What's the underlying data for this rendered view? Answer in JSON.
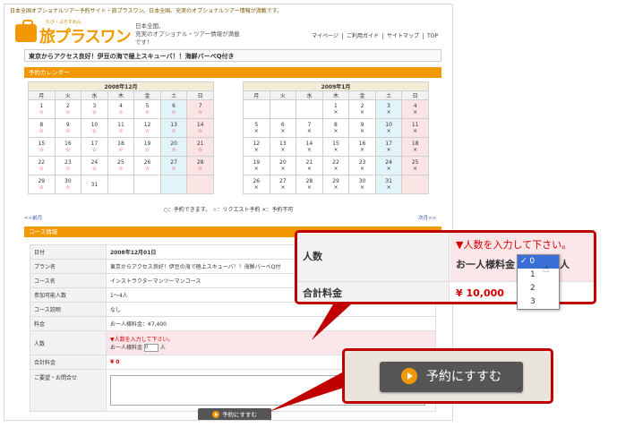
{
  "header": {
    "tagline_top": "日本全国オプショナルツアー予約サイト・旅プラスワン。日本全国、充実のオプショナルツアー情報が満載です。",
    "logo_ruby": "たび・ぷらすわん",
    "logo_text": "旅プラスワン",
    "tagline_lines": [
      "日本全国、",
      "充実のオプショナル・ツアー情報が満載です！"
    ],
    "nav": [
      "マイページ",
      "ご利用ガイド",
      "サイトマップ",
      "TOP"
    ]
  },
  "page_title": "東京からアクセス良好！伊豆の海で極上スキューバ！！海鮮バーベQ付き",
  "calendar": {
    "section_label": "予約カレンダー",
    "dow": [
      "月",
      "火",
      "水",
      "木",
      "金",
      "土",
      "日"
    ],
    "months": [
      {
        "caption": "2008年12月",
        "weeks": [
          [
            [
              "1",
              "☆"
            ],
            [
              "2",
              "☆"
            ],
            [
              "3",
              "☆"
            ],
            [
              "4",
              "☆"
            ],
            [
              "5",
              "☆"
            ],
            [
              "6",
              "☆"
            ],
            [
              "7",
              "☆"
            ]
          ],
          [
            [
              "8",
              "☆"
            ],
            [
              "9",
              "☆"
            ],
            [
              "10",
              "☆"
            ],
            [
              "11",
              "☆"
            ],
            [
              "12",
              "☆"
            ],
            [
              "13",
              "☆"
            ],
            [
              "14",
              "☆"
            ]
          ],
          [
            [
              "15",
              "☆"
            ],
            [
              "16",
              "☆"
            ],
            [
              "17",
              "☆"
            ],
            [
              "18",
              "☆"
            ],
            [
              "19",
              "☆"
            ],
            [
              "20",
              "☆"
            ],
            [
              "21",
              "☆"
            ]
          ],
          [
            [
              "22",
              "☆"
            ],
            [
              "23",
              "☆"
            ],
            [
              "24",
              "☆"
            ],
            [
              "25",
              "☆"
            ],
            [
              "26",
              "☆"
            ],
            [
              "27",
              "☆"
            ],
            [
              "28",
              "☆"
            ]
          ],
          [
            [
              "29",
              "☆"
            ],
            [
              "30",
              "☆"
            ],
            [
              "31",
              ""
            ],
            [
              "",
              ""
            ],
            [
              "",
              ""
            ],
            [
              "",
              ""
            ],
            [
              "",
              ""
            ]
          ]
        ]
      },
      {
        "caption": "2009年1月",
        "weeks": [
          [
            [
              "",
              ""
            ],
            [
              "",
              ""
            ],
            [
              "",
              ""
            ],
            [
              "1",
              "×"
            ],
            [
              "2",
              "×"
            ],
            [
              "3",
              "×"
            ],
            [
              "4",
              "×"
            ]
          ],
          [
            [
              "5",
              "×"
            ],
            [
              "6",
              "×"
            ],
            [
              "7",
              "×"
            ],
            [
              "8",
              "×"
            ],
            [
              "9",
              "×"
            ],
            [
              "10",
              "×"
            ],
            [
              "11",
              "×"
            ]
          ],
          [
            [
              "12",
              "×"
            ],
            [
              "13",
              "×"
            ],
            [
              "14",
              "×"
            ],
            [
              "15",
              "×"
            ],
            [
              "16",
              "×"
            ],
            [
              "17",
              "×"
            ],
            [
              "18",
              "×"
            ]
          ],
          [
            [
              "19",
              "×"
            ],
            [
              "20",
              "×"
            ],
            [
              "21",
              "×"
            ],
            [
              "22",
              "×"
            ],
            [
              "23",
              "×"
            ],
            [
              "24",
              "×"
            ],
            [
              "25",
              "×"
            ]
          ],
          [
            [
              "26",
              "×"
            ],
            [
              "27",
              "×"
            ],
            [
              "28",
              "×"
            ],
            [
              "29",
              "×"
            ],
            [
              "30",
              "×"
            ],
            [
              "31",
              "×"
            ],
            [
              "",
              ""
            ]
          ]
        ]
      }
    ],
    "legend": "○：予約できます。 ☆：リクエスト予約 ×：予約不可",
    "prev": "<<前月",
    "next": "次月>>"
  },
  "course": {
    "section_label": "コース情報",
    "rows": [
      {
        "k": "日付",
        "v": "2008年12月01日",
        "bold": true
      },
      {
        "k": "プラン名",
        "v": "東京からアクセス良好！伊豆の海で極上スキューバ！！海鮮バーベQ付"
      },
      {
        "k": "コース名",
        "v": "インストラクターマンツーマンコース"
      },
      {
        "k": "参加可能人数",
        "v": "1〜4人"
      },
      {
        "k": "コース説明",
        "v": "なし"
      },
      {
        "k": "料金",
        "v": "お一人様料金：¥7,400"
      }
    ],
    "people_label": "人数",
    "people_warning": "▼人数を入力して下さい。",
    "people_prefix": "お一人様料金",
    "people_value": "0",
    "people_unit": "人",
    "total_label": "合計料金",
    "total_value": "¥ 0",
    "inquiry_label": "ご要望・お問合せ",
    "submit_label": "予約にすすむ"
  },
  "callout_people": {
    "label": "人数",
    "warning": "▼人数を入力して下さい。",
    "prefix": "お一人様料金",
    "unit": "人",
    "total_label": "合計料金",
    "total_value": "¥ 10,000",
    "options": [
      "✓ 0",
      "1",
      "2",
      "3"
    ]
  },
  "callout_button": {
    "label": "予約にすすむ"
  },
  "colors": {
    "accent": "#f39800",
    "alert": "#d60000",
    "callout": "#c00000"
  }
}
